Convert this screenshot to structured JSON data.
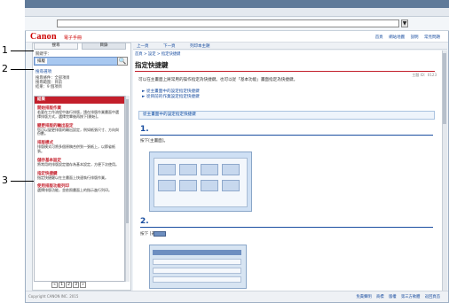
{
  "window": {
    "address_dropdown": "▼"
  },
  "header": {
    "logo": "Canon",
    "manual_title": "電子手冊",
    "links": [
      "首頁",
      "網站地圖",
      "說明",
      "常見問題"
    ]
  },
  "left_pane": {
    "tabs": [
      "搜尋",
      "目錄"
    ],
    "search_label": "關鍵字：",
    "search_term": "排版",
    "search_button": "🔍",
    "options_link": "搜尋選項",
    "info_lines": [
      "搜尋條件：全部項目",
      "搜尋範圍：目前",
      "結果：9 個項目"
    ],
    "results_header": "結果",
    "results": [
      {
        "title": "開始排版作業",
        "snippet": "若要在工作流程中進行排版，請在排版作業畫面中選擇排版方式，選擇完畢後再按下[開始]。"
      },
      {
        "title": "變更排版的輸出設定",
        "snippet": "您可以變更排版的輸出設定，例如紙張尺寸、方向與份數。"
      },
      {
        "title": "排版模式",
        "snippet": "排版模式可將多個原稿合併到一張紙上，以節省紙張。"
      },
      {
        "title": "儲存基本設定",
        "snippet": "將常用的排版設定儲存為基本設定，方便下次使用。"
      },
      {
        "title": "指定快捷鍵",
        "snippet": "指定快捷鍵以在主畫面上快速執行排版作業。"
      },
      {
        "title": "使用排版功能列印",
        "snippet": "選擇排版功能，並依照畫面上的指示進行列印。"
      }
    ],
    "pager": [
      "«",
      "1",
      "2",
      "3",
      "»"
    ]
  },
  "content": {
    "nav": [
      "上一頁",
      "下一頁",
      "列印本主題"
    ],
    "breadcrumb": "首頁 > 設定 > 指定快捷鍵",
    "title": "指定快捷鍵",
    "doc_id": "主題 ID：0123",
    "intro": "可以在主畫面上將常用的操作指定為快捷鍵。也可以從「基本功能」畫面指定為快捷鍵。",
    "links": [
      "► 從主畫面中的設定指定快捷鍵",
      "► 從目前的作業設定指定快捷鍵"
    ],
    "section": "從主畫面中的設定指定快捷鍵",
    "steps": [
      {
        "number": "1.",
        "text": "按下[主畫面]。"
      },
      {
        "number": "2.",
        "text": "按下 [選單]。"
      }
    ]
  },
  "footer": {
    "copyright": "Copyright CANON INC. 2015",
    "links": [
      "免責聲明",
      "商標",
      "版權",
      "第三方軟體",
      "返回頁首"
    ]
  },
  "callouts": [
    "1",
    "2",
    "3"
  ]
}
